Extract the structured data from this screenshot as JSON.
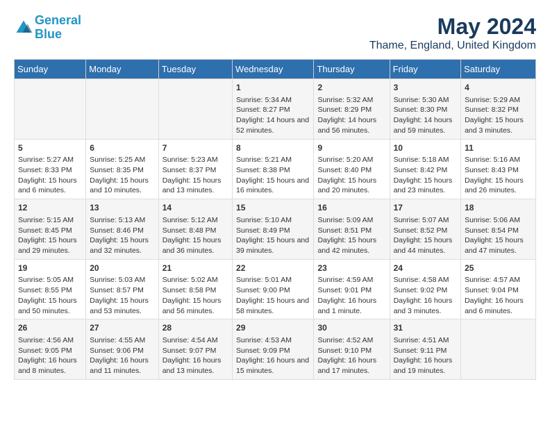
{
  "header": {
    "logo_line1": "General",
    "logo_line2": "Blue",
    "month_year": "May 2024",
    "location": "Thame, England, United Kingdom"
  },
  "weekdays": [
    "Sunday",
    "Monday",
    "Tuesday",
    "Wednesday",
    "Thursday",
    "Friday",
    "Saturday"
  ],
  "weeks": [
    [
      {
        "day": "",
        "info": ""
      },
      {
        "day": "",
        "info": ""
      },
      {
        "day": "",
        "info": ""
      },
      {
        "day": "1",
        "info": "Sunrise: 5:34 AM\nSunset: 8:27 PM\nDaylight: 14 hours and 52 minutes."
      },
      {
        "day": "2",
        "info": "Sunrise: 5:32 AM\nSunset: 8:29 PM\nDaylight: 14 hours and 56 minutes."
      },
      {
        "day": "3",
        "info": "Sunrise: 5:30 AM\nSunset: 8:30 PM\nDaylight: 14 hours and 59 minutes."
      },
      {
        "day": "4",
        "info": "Sunrise: 5:29 AM\nSunset: 8:32 PM\nDaylight: 15 hours and 3 minutes."
      }
    ],
    [
      {
        "day": "5",
        "info": "Sunrise: 5:27 AM\nSunset: 8:33 PM\nDaylight: 15 hours and 6 minutes."
      },
      {
        "day": "6",
        "info": "Sunrise: 5:25 AM\nSunset: 8:35 PM\nDaylight: 15 hours and 10 minutes."
      },
      {
        "day": "7",
        "info": "Sunrise: 5:23 AM\nSunset: 8:37 PM\nDaylight: 15 hours and 13 minutes."
      },
      {
        "day": "8",
        "info": "Sunrise: 5:21 AM\nSunset: 8:38 PM\nDaylight: 15 hours and 16 minutes."
      },
      {
        "day": "9",
        "info": "Sunrise: 5:20 AM\nSunset: 8:40 PM\nDaylight: 15 hours and 20 minutes."
      },
      {
        "day": "10",
        "info": "Sunrise: 5:18 AM\nSunset: 8:42 PM\nDaylight: 15 hours and 23 minutes."
      },
      {
        "day": "11",
        "info": "Sunrise: 5:16 AM\nSunset: 8:43 PM\nDaylight: 15 hours and 26 minutes."
      }
    ],
    [
      {
        "day": "12",
        "info": "Sunrise: 5:15 AM\nSunset: 8:45 PM\nDaylight: 15 hours and 29 minutes."
      },
      {
        "day": "13",
        "info": "Sunrise: 5:13 AM\nSunset: 8:46 PM\nDaylight: 15 hours and 32 minutes."
      },
      {
        "day": "14",
        "info": "Sunrise: 5:12 AM\nSunset: 8:48 PM\nDaylight: 15 hours and 36 minutes."
      },
      {
        "day": "15",
        "info": "Sunrise: 5:10 AM\nSunset: 8:49 PM\nDaylight: 15 hours and 39 minutes."
      },
      {
        "day": "16",
        "info": "Sunrise: 5:09 AM\nSunset: 8:51 PM\nDaylight: 15 hours and 42 minutes."
      },
      {
        "day": "17",
        "info": "Sunrise: 5:07 AM\nSunset: 8:52 PM\nDaylight: 15 hours and 44 minutes."
      },
      {
        "day": "18",
        "info": "Sunrise: 5:06 AM\nSunset: 8:54 PM\nDaylight: 15 hours and 47 minutes."
      }
    ],
    [
      {
        "day": "19",
        "info": "Sunrise: 5:05 AM\nSunset: 8:55 PM\nDaylight: 15 hours and 50 minutes."
      },
      {
        "day": "20",
        "info": "Sunrise: 5:03 AM\nSunset: 8:57 PM\nDaylight: 15 hours and 53 minutes."
      },
      {
        "day": "21",
        "info": "Sunrise: 5:02 AM\nSunset: 8:58 PM\nDaylight: 15 hours and 56 minutes."
      },
      {
        "day": "22",
        "info": "Sunrise: 5:01 AM\nSunset: 9:00 PM\nDaylight: 15 hours and 58 minutes."
      },
      {
        "day": "23",
        "info": "Sunrise: 4:59 AM\nSunset: 9:01 PM\nDaylight: 16 hours and 1 minute."
      },
      {
        "day": "24",
        "info": "Sunrise: 4:58 AM\nSunset: 9:02 PM\nDaylight: 16 hours and 3 minutes."
      },
      {
        "day": "25",
        "info": "Sunrise: 4:57 AM\nSunset: 9:04 PM\nDaylight: 16 hours and 6 minutes."
      }
    ],
    [
      {
        "day": "26",
        "info": "Sunrise: 4:56 AM\nSunset: 9:05 PM\nDaylight: 16 hours and 8 minutes."
      },
      {
        "day": "27",
        "info": "Sunrise: 4:55 AM\nSunset: 9:06 PM\nDaylight: 16 hours and 11 minutes."
      },
      {
        "day": "28",
        "info": "Sunrise: 4:54 AM\nSunset: 9:07 PM\nDaylight: 16 hours and 13 minutes."
      },
      {
        "day": "29",
        "info": "Sunrise: 4:53 AM\nSunset: 9:09 PM\nDaylight: 16 hours and 15 minutes."
      },
      {
        "day": "30",
        "info": "Sunrise: 4:52 AM\nSunset: 9:10 PM\nDaylight: 16 hours and 17 minutes."
      },
      {
        "day": "31",
        "info": "Sunrise: 4:51 AM\nSunset: 9:11 PM\nDaylight: 16 hours and 19 minutes."
      },
      {
        "day": "",
        "info": ""
      }
    ]
  ]
}
